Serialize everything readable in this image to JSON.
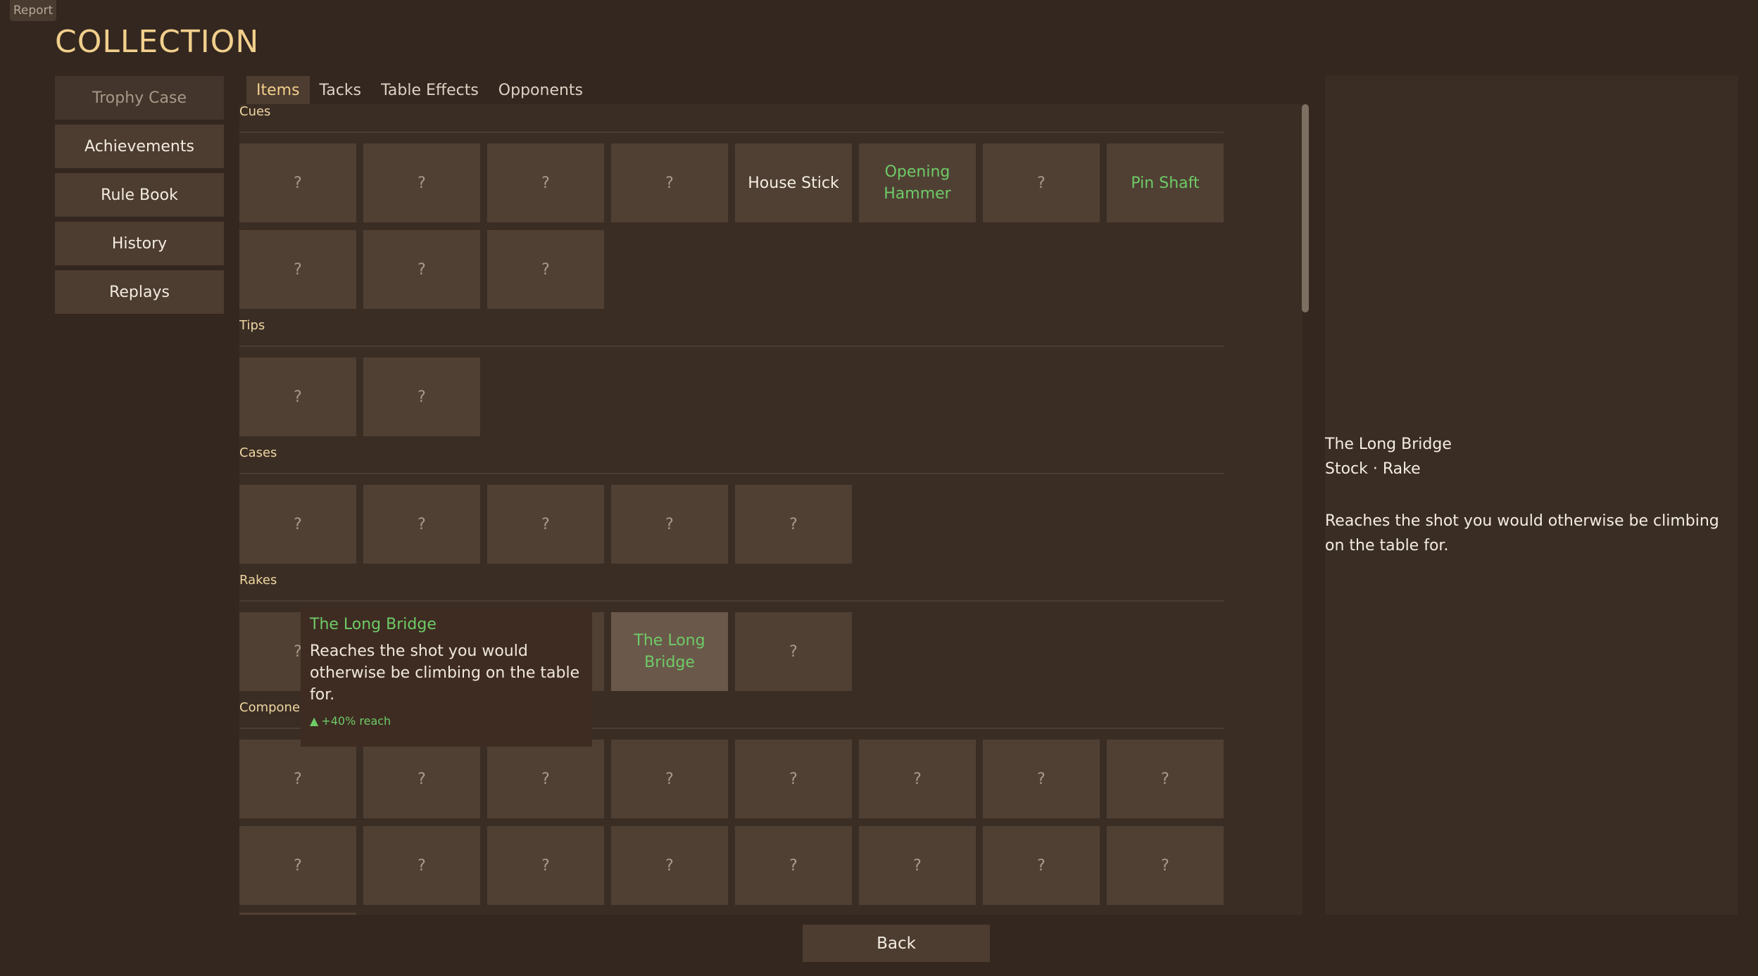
{
  "report_label": "Report",
  "title": "COLLECTION",
  "sidebar": {
    "items": [
      {
        "label": "Trophy Case"
      },
      {
        "label": "Achievements"
      },
      {
        "label": "Rule Book"
      },
      {
        "label": "History"
      },
      {
        "label": "Replays"
      }
    ]
  },
  "tabs": [
    {
      "label": "Items",
      "active": true
    },
    {
      "label": "Tacks"
    },
    {
      "label": "Table Effects"
    },
    {
      "label": "Opponents"
    }
  ],
  "sections": {
    "cues": {
      "label": "Cues",
      "cells": [
        "?",
        "?",
        "?",
        "?",
        "House Stick",
        "Opening Hammer",
        "?",
        "Pin Shaft",
        "?",
        "?",
        "?"
      ]
    },
    "tips": {
      "label": "Tips",
      "cells": [
        "?",
        "?"
      ]
    },
    "cases": {
      "label": "Cases",
      "cells": [
        "?",
        "?",
        "?",
        "?",
        "?"
      ]
    },
    "rakes": {
      "label": "Rakes",
      "cells": [
        "?",
        "?",
        "?",
        "The Long Bridge",
        "?"
      ]
    },
    "components": {
      "label": "Components",
      "cells": [
        "?",
        "?",
        "?",
        "?",
        "?",
        "?",
        "?",
        "?",
        "?",
        "?",
        "?",
        "?",
        "?",
        "?",
        "?",
        "?"
      ]
    }
  },
  "tooltip": {
    "title": "The Long Bridge",
    "description": "Reaches the shot you would otherwise be climbing on the table for.",
    "stat_arrow": "▲",
    "stat": "+40% reach"
  },
  "detail": {
    "name": "The Long Bridge",
    "type": "Stock · Rake",
    "description": "Reaches the shot you would otherwise be climbing on the table for."
  },
  "back_label": "Back",
  "colors": {
    "background": "#33271f",
    "title": "#f1cf8c",
    "owned_green": "#6ecb67",
    "cell": "#504034"
  }
}
